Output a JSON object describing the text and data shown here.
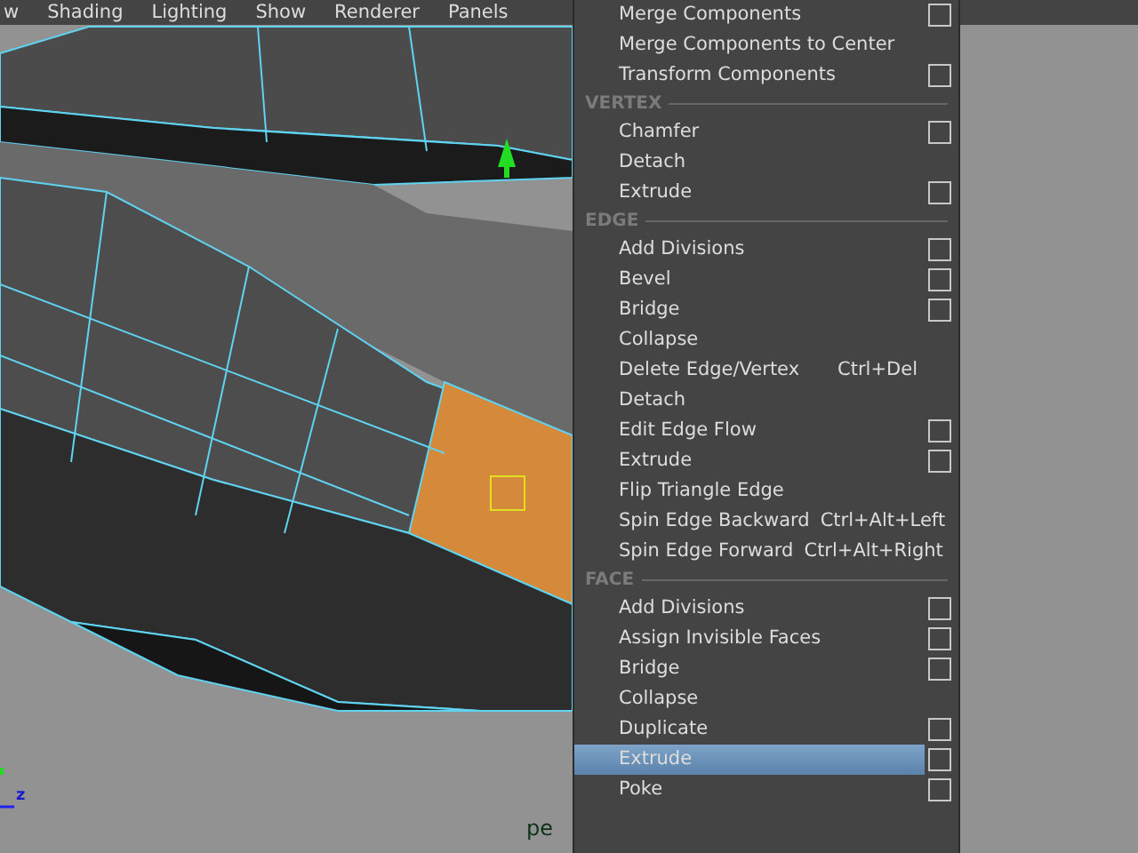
{
  "menu_bar": {
    "items": [
      "w",
      "Shading",
      "Lighting",
      "Show",
      "Renderer",
      "Panels"
    ]
  },
  "viewport": {
    "camera_label": "pe",
    "axis_label": "z"
  },
  "context_menu": {
    "sections": [
      {
        "items": [
          {
            "label": "Merge Components",
            "has_options": true,
            "selected": false
          },
          {
            "label": "Merge Components to Center",
            "has_options": false,
            "selected": false
          },
          {
            "label": "Transform Components",
            "has_options": true,
            "selected": false
          }
        ]
      },
      {
        "header": "VERTEX",
        "items": [
          {
            "label": "Chamfer",
            "has_options": true,
            "selected": false
          },
          {
            "label": "Detach",
            "has_options": false,
            "selected": false
          },
          {
            "label": "Extrude",
            "has_options": true,
            "selected": false
          }
        ]
      },
      {
        "header": "EDGE",
        "items": [
          {
            "label": "Add Divisions",
            "has_options": true,
            "selected": false
          },
          {
            "label": "Bevel",
            "has_options": true,
            "selected": false
          },
          {
            "label": "Bridge",
            "has_options": true,
            "selected": false
          },
          {
            "label": "Collapse",
            "has_options": false,
            "selected": false
          },
          {
            "label": "Delete Edge/Vertex",
            "shortcut": "Ctrl+Del",
            "has_options": false,
            "selected": false
          },
          {
            "label": "Detach",
            "has_options": false,
            "selected": false
          },
          {
            "label": "Edit Edge Flow",
            "has_options": true,
            "selected": false
          },
          {
            "label": "Extrude",
            "has_options": true,
            "selected": false
          },
          {
            "label": "Flip Triangle Edge",
            "has_options": false,
            "selected": false
          },
          {
            "label": "Spin Edge Backward",
            "shortcut": "Ctrl+Alt+Left",
            "has_options": false,
            "selected": false
          },
          {
            "label": "Spin Edge Forward",
            "shortcut": "Ctrl+Alt+Right",
            "has_options": false,
            "selected": false
          }
        ]
      },
      {
        "header": "FACE",
        "items": [
          {
            "label": "Add Divisions",
            "has_options": true,
            "selected": false
          },
          {
            "label": "Assign Invisible Faces",
            "has_options": true,
            "selected": false
          },
          {
            "label": "Bridge",
            "has_options": true,
            "selected": false
          },
          {
            "label": "Collapse",
            "has_options": false,
            "selected": false
          },
          {
            "label": "Duplicate",
            "has_options": true,
            "selected": false
          },
          {
            "label": "Extrude",
            "has_options": true,
            "selected": true
          },
          {
            "label": "Poke",
            "has_options": true,
            "selected": false
          }
        ]
      }
    ]
  }
}
